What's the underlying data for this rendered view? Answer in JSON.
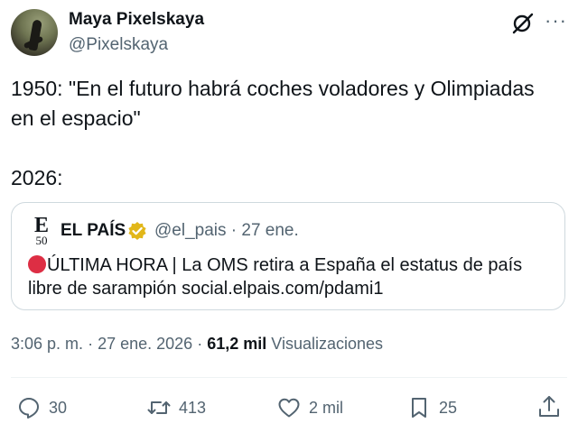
{
  "author": {
    "name": "Maya Pixelskaya",
    "handle": "@Pixelskaya"
  },
  "tweet": {
    "text": "1950: \"En el futuro habrá coches voladores y Olimpiadas en el espacio\"\n\n2026:"
  },
  "quote": {
    "logo_letter": "E",
    "logo_number": "50",
    "name": "EL PAÍS",
    "handle": "@el_pais",
    "separator": "·",
    "date": "27 ene.",
    "text": "ÚLTIMA HORA | La OMS retira a España el estatus de país libre de sarampión social.elpais.com/pdami1"
  },
  "meta": {
    "time": "3:06 p. m.",
    "separator1": "·",
    "date": "27 ene. 2026",
    "separator2": "·",
    "views_count": "61,2 mil",
    "views_label": "Visualizaciones"
  },
  "actions": {
    "replies": "30",
    "reposts": "413",
    "likes": "2 mil",
    "bookmarks": "25"
  },
  "icons": {
    "grok": "grok-icon",
    "more": "more-icon",
    "verified": "verified-badge-icon",
    "reply": "reply-icon",
    "repost": "repost-icon",
    "like": "heart-icon",
    "bookmark": "bookmark-icon",
    "share": "share-icon"
  },
  "colors": {
    "text": "#0f1419",
    "secondary": "#536471",
    "verified_gold": "#e2b719",
    "breaking_red": "#dd2e44"
  }
}
